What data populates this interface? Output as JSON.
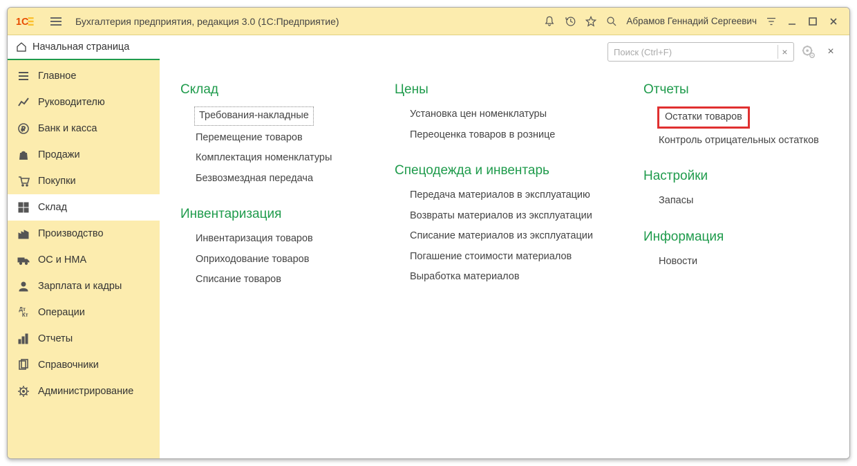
{
  "titlebar": {
    "app_title": "Бухгалтерия предприятия, редакция 3.0  (1С:Предприятие)",
    "user_name": "Абрамов Геннадий Сергеевич"
  },
  "start_page_label": "Начальная страница",
  "nav": [
    {
      "label": "Главное",
      "icon": "menu"
    },
    {
      "label": "Руководителю",
      "icon": "trend"
    },
    {
      "label": "Банк и касса",
      "icon": "ruble"
    },
    {
      "label": "Продажи",
      "icon": "bag"
    },
    {
      "label": "Покупки",
      "icon": "cart"
    },
    {
      "label": "Склад",
      "icon": "grid",
      "active": true
    },
    {
      "label": "Производство",
      "icon": "factory"
    },
    {
      "label": "ОС и НМА",
      "icon": "truck"
    },
    {
      "label": "Зарплата и кадры",
      "icon": "person"
    },
    {
      "label": "Операции",
      "icon": "dtkt"
    },
    {
      "label": "Отчеты",
      "icon": "bars"
    },
    {
      "label": "Справочники",
      "icon": "books"
    },
    {
      "label": "Администрирование",
      "icon": "gear"
    }
  ],
  "search": {
    "placeholder": "Поиск (Ctrl+F)"
  },
  "columns": [
    {
      "sections": [
        {
          "title": "Склад",
          "links": [
            {
              "label": "Требования-накладные",
              "dotted": true
            },
            {
              "label": "Перемещение товаров"
            },
            {
              "label": "Комплектация номенклатуры"
            },
            {
              "label": "Безвозмездная передача"
            }
          ]
        },
        {
          "title": "Инвентаризация",
          "links": [
            {
              "label": "Инвентаризация товаров"
            },
            {
              "label": "Оприходование товаров"
            },
            {
              "label": "Списание товаров"
            }
          ]
        }
      ]
    },
    {
      "sections": [
        {
          "title": "Цены",
          "links": [
            {
              "label": "Установка цен номенклатуры"
            },
            {
              "label": "Переоценка товаров в рознице"
            }
          ]
        },
        {
          "title": "Спецодежда и инвентарь",
          "links": [
            {
              "label": "Передача материалов в эксплуатацию"
            },
            {
              "label": "Возвраты материалов из эксплуатации"
            },
            {
              "label": "Списание материалов из эксплуатации"
            },
            {
              "label": "Погашение стоимости материалов"
            },
            {
              "label": "Выработка материалов"
            }
          ]
        }
      ]
    },
    {
      "sections": [
        {
          "title": "Отчеты",
          "links": [
            {
              "label": "Остатки товаров",
              "highlight": true
            },
            {
              "label": "Контроль отрицательных остатков"
            }
          ]
        },
        {
          "title": "Настройки",
          "links": [
            {
              "label": "Запасы"
            }
          ]
        },
        {
          "title": "Информация",
          "links": [
            {
              "label": "Новости"
            }
          ]
        }
      ]
    }
  ]
}
